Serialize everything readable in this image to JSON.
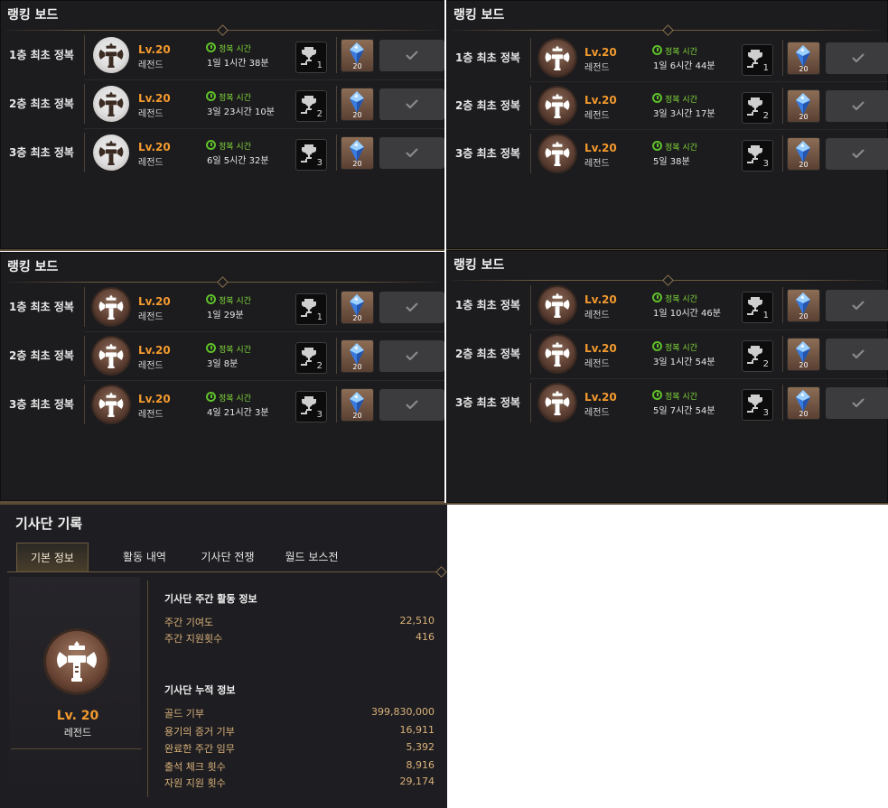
{
  "panels": [
    {
      "title": "랭킹 보드",
      "rows": [
        {
          "label": "1층 최초 정복",
          "level": "Lv.20",
          "grade": "레전드",
          "time_label": "정복 시간",
          "time": "1일 1시간 38분",
          "rank": "1",
          "reward_count": "20"
        },
        {
          "label": "2층 최초 정복",
          "level": "Lv.20",
          "grade": "레전드",
          "time_label": "정복 시간",
          "time": "3일 23시간 10분",
          "rank": "2",
          "reward_count": "20"
        },
        {
          "label": "3층 최초 정복",
          "level": "Lv.20",
          "grade": "레전드",
          "time_label": "정복 시간",
          "time": "6일 5시간 32분",
          "rank": "3",
          "reward_count": "20"
        }
      ]
    },
    {
      "title": "랭킹 보드",
      "rows": [
        {
          "label": "1층 최초 정복",
          "level": "Lv.20",
          "grade": "레전드",
          "time_label": "정복 시간",
          "time": "1일 6시간 44분",
          "rank": "1",
          "reward_count": "20"
        },
        {
          "label": "2층 최초 정복",
          "level": "Lv.20",
          "grade": "레전드",
          "time_label": "정복 시간",
          "time": "3일 3시간 17분",
          "rank": "2",
          "reward_count": "20"
        },
        {
          "label": "3층 최초 정복",
          "level": "Lv.20",
          "grade": "레전드",
          "time_label": "정복 시간",
          "time": "5일 38분",
          "rank": "3",
          "reward_count": "20"
        }
      ]
    },
    {
      "title": "랭킹 보드",
      "rows": [
        {
          "label": "1층 최초 정복",
          "level": "Lv.20",
          "grade": "레전드",
          "time_label": "정복 시간",
          "time": "1일 29분",
          "rank": "1",
          "reward_count": "20"
        },
        {
          "label": "2층 최초 정복",
          "level": "Lv.20",
          "grade": "레전드",
          "time_label": "정복 시간",
          "time": "3일 8분",
          "rank": "2",
          "reward_count": "20"
        },
        {
          "label": "3층 최초 정복",
          "level": "Lv.20",
          "grade": "레전드",
          "time_label": "정복 시간",
          "time": "4일 21시간 3분",
          "rank": "3",
          "reward_count": "20"
        }
      ]
    },
    {
      "title": "랭킹 보드",
      "rows": [
        {
          "label": "1층 최초 정복",
          "level": "Lv.20",
          "grade": "레전드",
          "time_label": "정복 시간",
          "time": "1일 10시간 46분",
          "rank": "1",
          "reward_count": "20"
        },
        {
          "label": "2층 최초 정복",
          "level": "Lv.20",
          "grade": "레전드",
          "time_label": "정복 시간",
          "time": "3일 1시간 54분",
          "rank": "2",
          "reward_count": "20"
        },
        {
          "label": "3층 최초 정복",
          "level": "Lv.20",
          "grade": "레전드",
          "time_label": "정복 시간",
          "time": "5일 7시간 54분",
          "rank": "3",
          "reward_count": "20"
        }
      ]
    }
  ],
  "guild": {
    "title": "기사단 기록",
    "tabs": [
      "기본 정보",
      "활동 내역",
      "기사단 전쟁",
      "월드 보스전"
    ],
    "level": "Lv. 20",
    "grade": "레전드",
    "weekly_title": "기사단 주간 활동 정보",
    "weekly": [
      {
        "key": "주간 기여도",
        "value": "22,510"
      },
      {
        "key": "주간 지원횟수",
        "value": "416"
      }
    ],
    "total_title": "기사단 누적 정보",
    "total": [
      {
        "key": "골드 기부",
        "value": "399,830,000"
      },
      {
        "key": "용기의 증거 기부",
        "value": "16,911"
      },
      {
        "key": "완료한 주간 임무",
        "value": "5,392"
      },
      {
        "key": "출석 체크 횟수",
        "value": "8,916"
      },
      {
        "key": "자원 지원 횟수",
        "value": "29,174"
      }
    ]
  },
  "icons": {
    "emblem": "guild-emblem-hammer-icon",
    "clock": "clock-icon",
    "trophy": "trophy-stairs-icon",
    "crystal": "blue-crystal-icon",
    "check": "check-icon"
  },
  "colors": {
    "level": "#f29a2e",
    "time_label": "#7fd83a",
    "stat": "#d9b27a",
    "border": "#6e5b40"
  }
}
